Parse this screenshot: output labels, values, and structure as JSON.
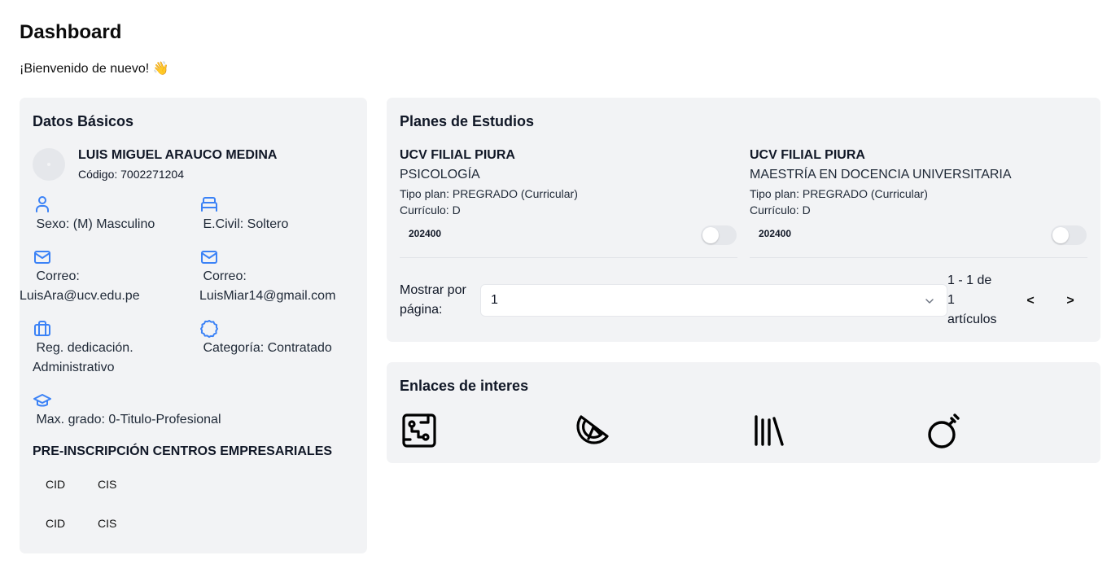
{
  "header": {
    "title": "Dashboard",
    "welcome": "¡Bienvenido de nuevo! 👋"
  },
  "datos_basicos": {
    "title": "Datos Básicos",
    "name": "LUIS MIGUEL ARAUCO MEDINA",
    "code": "Código: 7002271204",
    "sexo": " Sexo: (M) Masculino",
    "civil": " E.Civil: Soltero",
    "correo_label_1": " Correo:",
    "correo_value_1": "LuisAra@ucv.edu.pe",
    "correo_label_2": " Correo:",
    "correo_value_2": "LuisMiar14@gmail.com",
    "dedicacion_line1": " Reg. dedicación.",
    "dedicacion_line2": "Administrativo",
    "categoria": " Categoría: Contratado",
    "grado": " Max. grado: 0-Titulo-Profesional",
    "icons": [
      "user-icon",
      "bed-icon",
      "mail-icon",
      "mail-icon",
      "briefcase-icon",
      "badge-icon",
      "graduation-cap-icon"
    ],
    "accent_color": "#3b82f6"
  },
  "pre_inscripcion": {
    "title": "PRE-INSCRIPCIÓN CENTROS EMPRESARIALES",
    "rows": [
      [
        "CID",
        "CIS"
      ],
      [
        "CID",
        "CIS"
      ]
    ]
  },
  "planes": {
    "title": "Planes de Estudios",
    "items": [
      {
        "campus": "UCV FILIAL PIURA",
        "program": "PSICOLOGÍA",
        "type": "Tipo plan: PREGRADO (Curricular)",
        "curriculum": "Currículo: D",
        "code": "202400",
        "enabled": false
      },
      {
        "campus": "UCV FILIAL PIURA",
        "program": "MAESTRÍA EN DOCENCIA UNIVERSITARIA",
        "type": "Tipo plan: PREGRADO (Curricular)",
        "curriculum": "Currículo: D",
        "code": "202400",
        "enabled": false
      }
    ],
    "pagination": {
      "per_page_label_1": "Mostrar por",
      "per_page_label_2": "página:",
      "per_page_value": "1",
      "range_1": "1 - 1 de",
      "range_2": "1",
      "range_3": "artículos",
      "prev": "<",
      "next": ">"
    }
  },
  "enlaces": {
    "title": "Enlaces de interes",
    "icons": [
      "circuit-board-icon",
      "citrus-icon",
      "library-icon",
      "bomb-icon"
    ]
  }
}
